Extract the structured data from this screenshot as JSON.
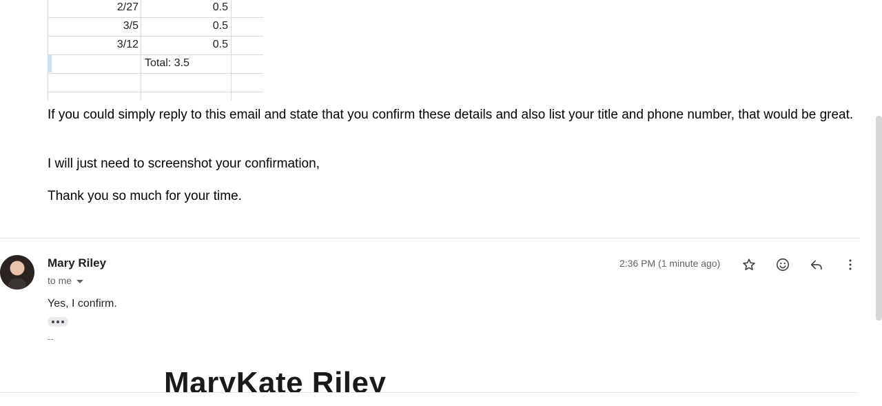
{
  "sheet": {
    "rows": [
      {
        "date": "2/27",
        "hours": "0.5"
      },
      {
        "date": "3/5",
        "hours": "0.5"
      },
      {
        "date": "3/12",
        "hours": "0.5"
      }
    ],
    "total": "Total: 3.5"
  },
  "body_paragraphs": [
    "If you could simply reply to this email and state that you confirm these details and also list your title and phone number, that would be great.",
    "I will just need to screenshot your confirmation,",
    "Thank you so much for your time."
  ],
  "reply": {
    "sender": "Mary Riley",
    "recipient": "to me",
    "time": "2:36 PM (1 minute ago)",
    "text": "Yes, I confirm.",
    "sig_dash": "--",
    "signature_name": "MaryKate Riley"
  },
  "icons": [
    "star-icon",
    "emoji-icon",
    "reply-icon",
    "more-vert-icon",
    "chevron-down-icon"
  ]
}
